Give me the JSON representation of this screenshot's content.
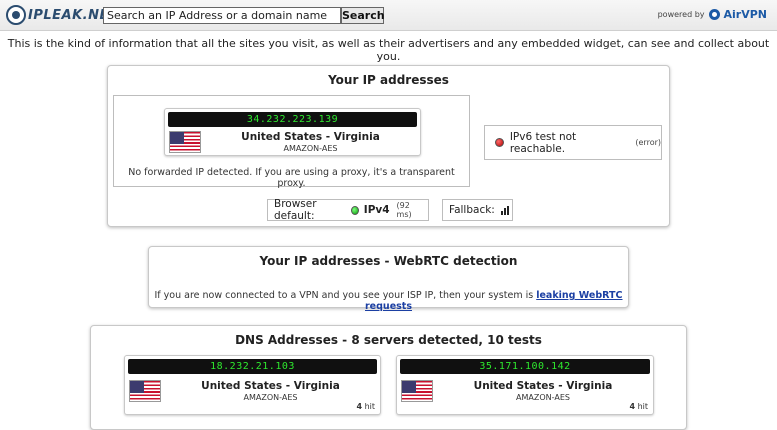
{
  "header": {
    "logo_text": "IPLEAK.NET",
    "search_placeholder": "Search an IP Address or a domain name",
    "search_button": "Search",
    "powered_by": "powered by",
    "powered_brand": "AirVPN"
  },
  "intro": "This is the kind of information that all the sites you visit, as well as their advertisers and any embedded widget, can see and collect about you.",
  "ip_panel": {
    "title": "Your IP addresses",
    "main_ip": {
      "ip": "34.232.223.139",
      "country": "United States - Virginia",
      "isp": "AMAZON-AES",
      "flag": "us-flag-icon"
    },
    "forwarded_note": "No forwarded IP detected. If you are using a proxy, it's a transparent proxy.",
    "ipv6": {
      "text": "IPv6 test not reachable.",
      "detail": "(error)",
      "status_color": "#cc0000"
    },
    "browser_default": {
      "label": "Browser default:",
      "protocol": "IPv4",
      "latency": "(92 ms)",
      "status_color": "#11aa11"
    },
    "fallback": {
      "label": "Fallback:"
    }
  },
  "webrtc_panel": {
    "title": "Your IP addresses - WebRTC detection",
    "text": "If you are now connected to a VPN and you see your ISP IP, then your system is",
    "link": "leaking WebRTC requests"
  },
  "dns_panel": {
    "title": "DNS Addresses - 8 servers detected, 10 tests",
    "servers": [
      {
        "ip": "18.232.21.103",
        "country": "United States - Virginia",
        "isp": "AMAZON-AES",
        "hits": "4",
        "hit_label": "hit"
      },
      {
        "ip": "35.171.100.142",
        "country": "United States - Virginia",
        "isp": "AMAZON-AES",
        "hits": "4",
        "hit_label": "hit"
      }
    ]
  },
  "colors": {
    "ip_text": "#2ee82e",
    "ip_bar": "#101010",
    "link": "#1b3fa3"
  }
}
